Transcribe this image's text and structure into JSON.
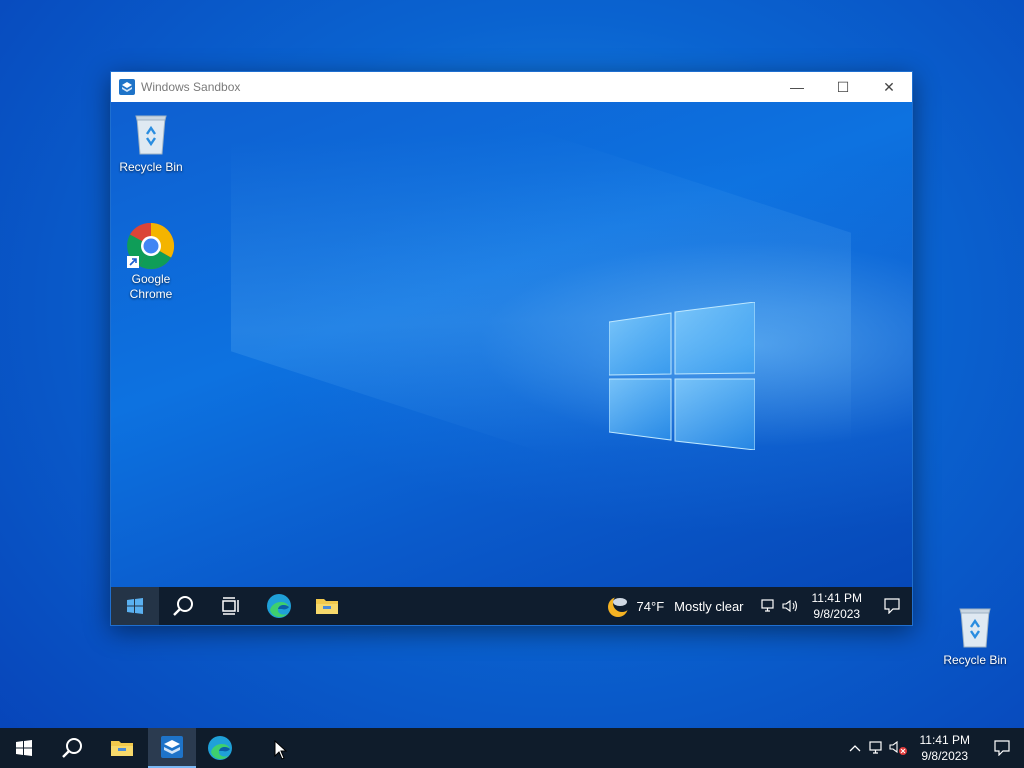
{
  "host": {
    "desktop_icons": [
      {
        "label": "Recycle Bin",
        "icon": "recycle-bin-icon"
      }
    ],
    "taskbar": {
      "apps": [
        "start-icon",
        "search-icon",
        "file-explorer-icon",
        "windows-sandbox-icon",
        "edge-icon"
      ],
      "clock_time": "11:41 PM",
      "clock_date": "9/8/2023"
    }
  },
  "sandbox_window": {
    "title": "Windows Sandbox",
    "minimize_label": "—",
    "maximize_label": "☐",
    "close_label": "✕",
    "desktop_icons": [
      {
        "label": "Recycle Bin",
        "icon": "recycle-bin-icon"
      },
      {
        "label": "Google Chrome",
        "icon": "chrome-icon"
      }
    ],
    "taskbar": {
      "weather_temp": "74°F",
      "weather_desc": "Mostly clear",
      "clock_time": "11:41 PM",
      "clock_date": "9/8/2023"
    }
  },
  "colors": {
    "accent": "#0a63d0",
    "taskbar": "#0f1c2b"
  }
}
